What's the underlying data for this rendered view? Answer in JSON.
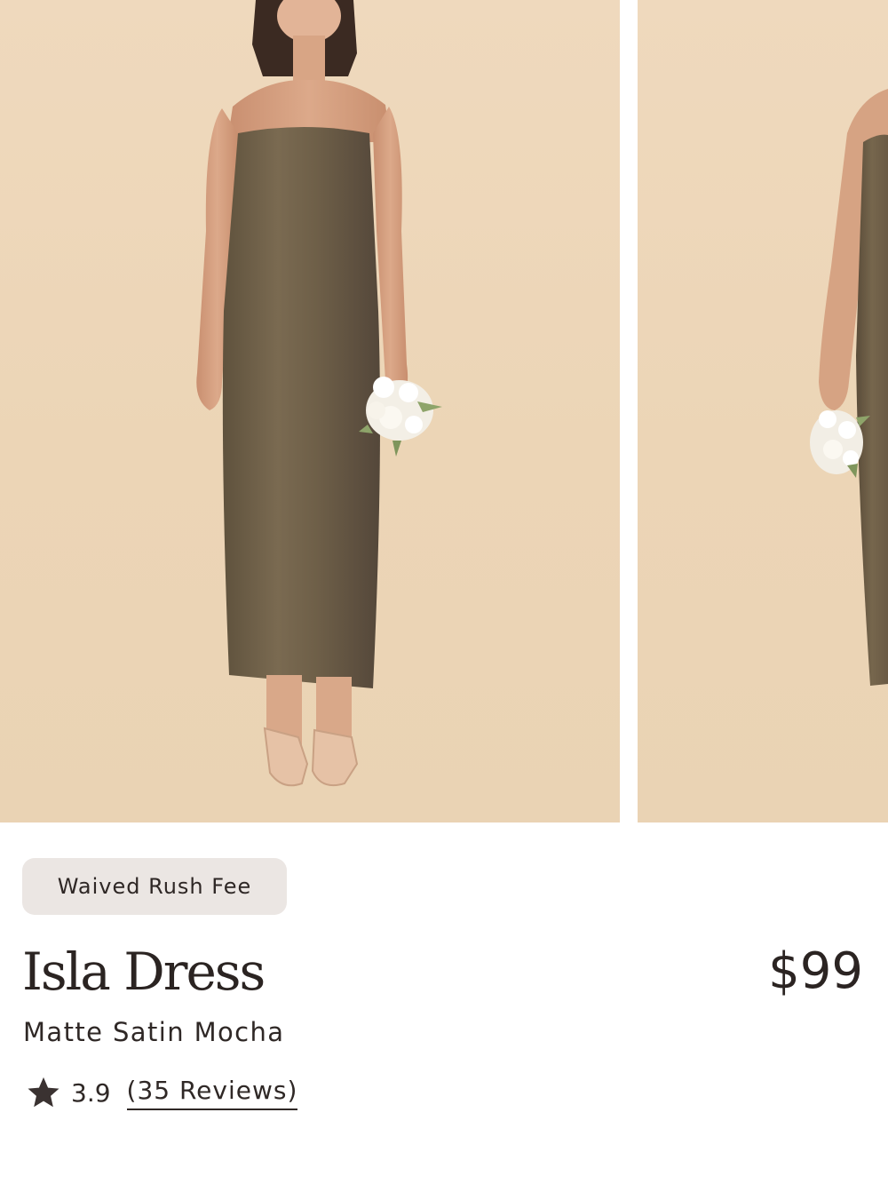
{
  "product": {
    "badge": "Waived Rush Fee",
    "name": "Isla Dress",
    "color_name": "Matte Satin Mocha",
    "price": "$99",
    "rating": "3.9",
    "reviews_label": "(35 Reviews)"
  },
  "gallery": {
    "images": [
      {
        "icon": "model-front-photo"
      },
      {
        "icon": "model-alt-photo"
      }
    ],
    "colors": {
      "background": "#ecd6b8",
      "dress": "#6e5f48",
      "skin": "#d9a889"
    }
  },
  "icons": {
    "rating": "star-icon"
  }
}
